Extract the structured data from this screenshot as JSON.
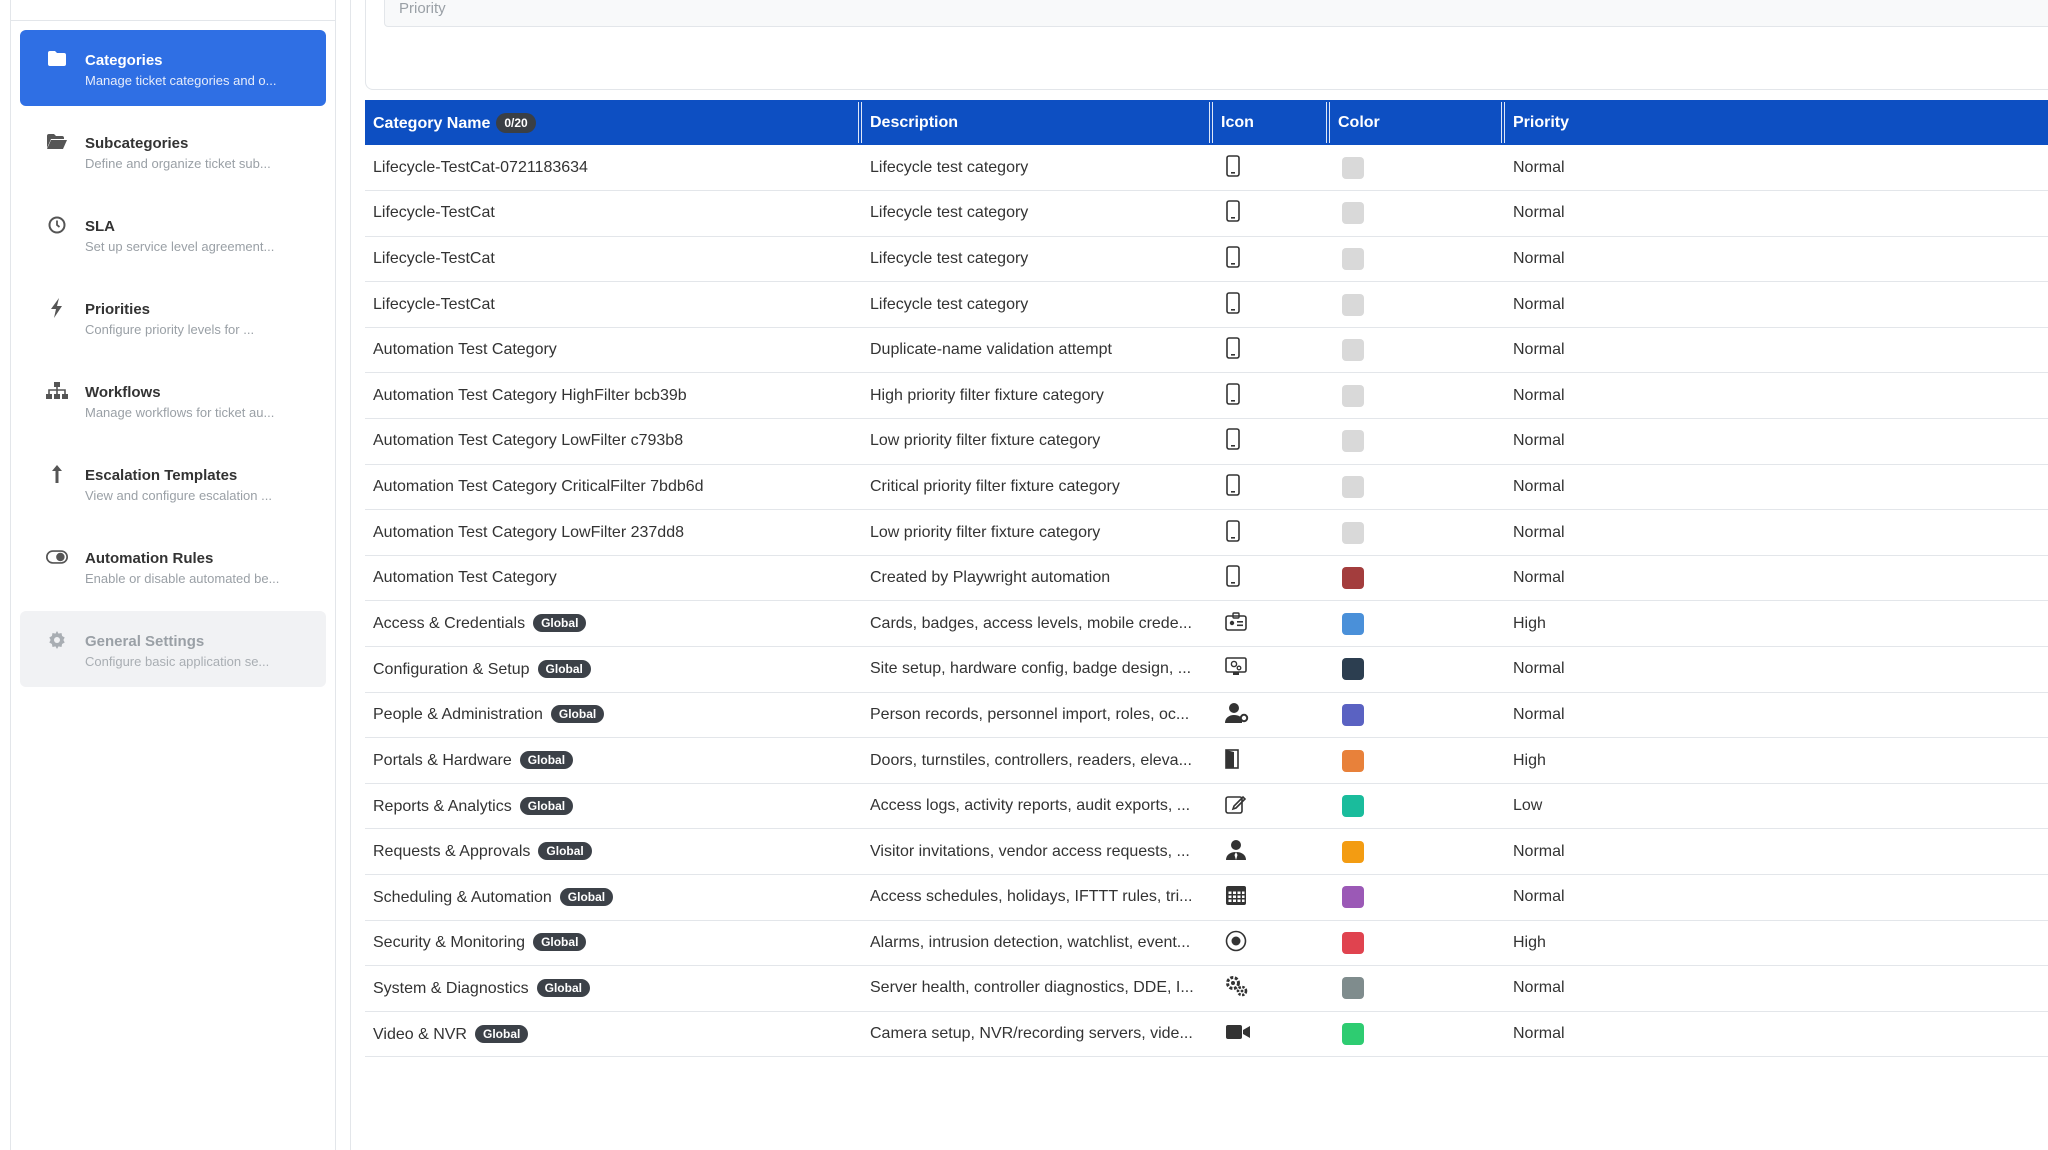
{
  "sidebar": {
    "items": [
      {
        "key": "categories",
        "title": "Categories",
        "sub": "Manage ticket categories and o...",
        "icon": "folder-icon",
        "state": "active"
      },
      {
        "key": "subcategories",
        "title": "Subcategories",
        "sub": "Define and organize ticket sub...",
        "icon": "folder-open-icon",
        "state": ""
      },
      {
        "key": "sla",
        "title": "SLA",
        "sub": "Set up service level agreement...",
        "icon": "clock-icon",
        "state": ""
      },
      {
        "key": "priorities",
        "title": "Priorities",
        "sub": "Configure priority levels for ...",
        "icon": "bolt-icon",
        "state": ""
      },
      {
        "key": "workflows",
        "title": "Workflows",
        "sub": "Manage workflows for ticket au...",
        "icon": "sitemap-icon",
        "state": ""
      },
      {
        "key": "escalation",
        "title": "Escalation Templates",
        "sub": "View and configure escalation ...",
        "icon": "arrow-up-icon",
        "state": ""
      },
      {
        "key": "automation",
        "title": "Automation Rules",
        "sub": "Enable or disable automated be...",
        "icon": "toggle-icon",
        "state": ""
      },
      {
        "key": "general",
        "title": "General Settings",
        "sub": "Configure basic application se...",
        "icon": "gear-icon",
        "state": "muted"
      }
    ]
  },
  "filter": {
    "priority_placeholder": "Priority"
  },
  "table": {
    "headers": {
      "name": "Category Name",
      "count": "0/20",
      "description": "Description",
      "icon": "Icon",
      "color": "Color",
      "priority": "Priority"
    },
    "badge_label": "Global",
    "rows": [
      {
        "name": "Lifecycle-TestCat-0721183634",
        "global": false,
        "description": "Lifecycle test category",
        "icon": "mobile-icon",
        "color": "#d9d9d9",
        "priority": "Normal"
      },
      {
        "name": "Lifecycle-TestCat",
        "global": false,
        "description": "Lifecycle test category",
        "icon": "mobile-icon",
        "color": "#d9d9d9",
        "priority": "Normal"
      },
      {
        "name": "Lifecycle-TestCat",
        "global": false,
        "description": "Lifecycle test category",
        "icon": "mobile-icon",
        "color": "#d9d9d9",
        "priority": "Normal"
      },
      {
        "name": "Lifecycle-TestCat",
        "global": false,
        "description": "Lifecycle test category",
        "icon": "mobile-icon",
        "color": "#d9d9d9",
        "priority": "Normal"
      },
      {
        "name": "Automation Test Category",
        "global": false,
        "description": "Duplicate-name validation attempt",
        "icon": "mobile-icon",
        "color": "#d9d9d9",
        "priority": "Normal"
      },
      {
        "name": "Automation Test Category HighFilter bcb39b",
        "global": false,
        "description": "High priority filter fixture category",
        "icon": "mobile-icon",
        "color": "#d9d9d9",
        "priority": "Normal"
      },
      {
        "name": "Automation Test Category LowFilter c793b8",
        "global": false,
        "description": "Low priority filter fixture category",
        "icon": "mobile-icon",
        "color": "#d9d9d9",
        "priority": "Normal"
      },
      {
        "name": "Automation Test Category CriticalFilter 7bdb6d",
        "global": false,
        "description": "Critical priority filter fixture category",
        "icon": "mobile-icon",
        "color": "#d9d9d9",
        "priority": "Normal"
      },
      {
        "name": "Automation Test Category LowFilter 237dd8",
        "global": false,
        "description": "Low priority filter fixture category",
        "icon": "mobile-icon",
        "color": "#d9d9d9",
        "priority": "Normal"
      },
      {
        "name": "Automation Test Category",
        "global": false,
        "description": "Created by Playwright automation",
        "icon": "mobile-icon",
        "color": "#a33d3d",
        "priority": "Normal"
      },
      {
        "name": "Access & Credentials",
        "global": true,
        "description": "Cards, badges, access levels, mobile crede...",
        "icon": "id-card-icon",
        "color": "#4a90d9",
        "priority": "High"
      },
      {
        "name": "Configuration & Setup",
        "global": true,
        "description": "Site setup, hardware config, badge design, ...",
        "icon": "monitor-gear-icon",
        "color": "#2c3e50",
        "priority": "Normal"
      },
      {
        "name": "People & Administration",
        "global": true,
        "description": "Person records, personnel import, roles, oc...",
        "icon": "user-gear-icon",
        "color": "#5a62c2",
        "priority": "Normal"
      },
      {
        "name": "Portals & Hardware",
        "global": true,
        "description": "Doors, turnstiles, controllers, readers, eleva...",
        "icon": "door-icon",
        "color": "#e8813a",
        "priority": "High"
      },
      {
        "name": "Reports & Analytics",
        "global": true,
        "description": "Access logs, activity reports, audit exports, ...",
        "icon": "edit-icon",
        "color": "#1abc9c",
        "priority": "Low"
      },
      {
        "name": "Requests & Approvals",
        "global": true,
        "description": "Visitor invitations, vendor access requests, ...",
        "icon": "user-tie-icon",
        "color": "#f39c12",
        "priority": "Normal"
      },
      {
        "name": "Scheduling & Automation",
        "global": true,
        "description": "Access schedules, holidays, IFTTT rules, tri...",
        "icon": "calendar-icon",
        "color": "#9b59b6",
        "priority": "Normal"
      },
      {
        "name": "Security & Monitoring",
        "global": true,
        "description": "Alarms, intrusion detection, watchlist, event...",
        "icon": "dot-circle-icon",
        "color": "#e0434f",
        "priority": "High"
      },
      {
        "name": "System & Diagnostics",
        "global": true,
        "description": "Server health, controller diagnostics, DDE, I...",
        "icon": "cogs-icon",
        "color": "#7f8c8d",
        "priority": "Normal"
      },
      {
        "name": "Video & NVR",
        "global": true,
        "description": "Camera setup, NVR/recording servers, vide...",
        "icon": "video-icon",
        "color": "#2ecc71",
        "priority": "Normal"
      }
    ]
  }
}
